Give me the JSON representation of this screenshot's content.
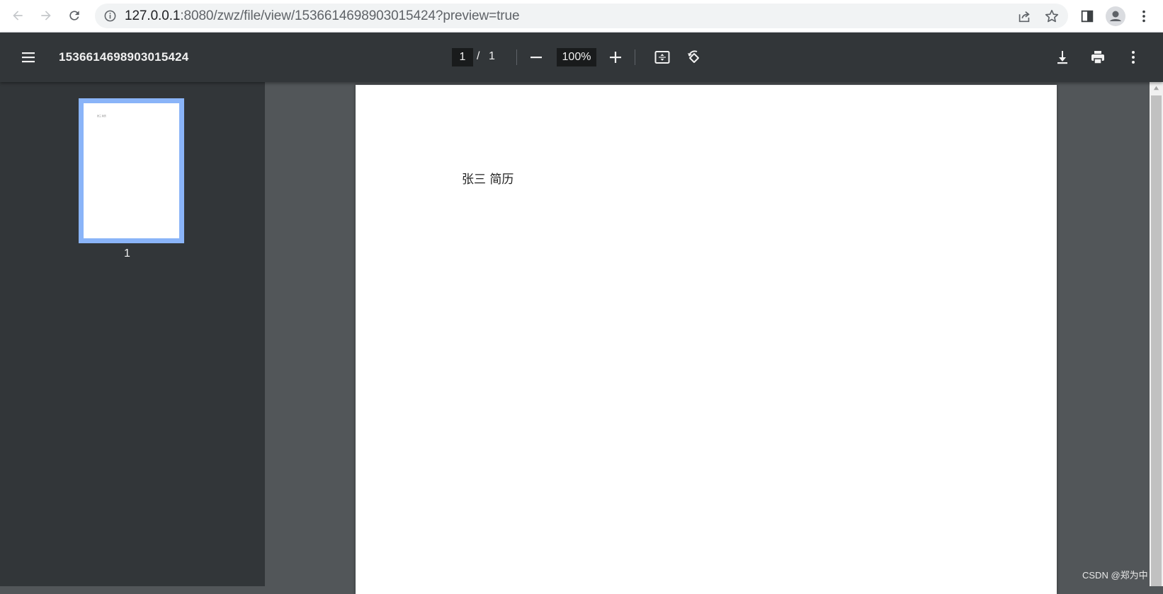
{
  "browser": {
    "url_host": "127.0.0.1",
    "url_rest": ":8080/zwz/file/view/1536614698903015424?preview=true"
  },
  "pdf_toolbar": {
    "title": "1536614698903015424",
    "current_page": "1",
    "page_separator": "/",
    "total_pages": "1",
    "zoom": "100%"
  },
  "sidebar": {
    "thumbnails": [
      {
        "page_number": "1"
      }
    ]
  },
  "document": {
    "text": "张三  简历"
  },
  "watermark": "CSDN @郑为中",
  "colors": {
    "toolbar_bg": "#323639",
    "viewer_bg": "#525659",
    "thumb_highlight": "#8ab4f8"
  }
}
